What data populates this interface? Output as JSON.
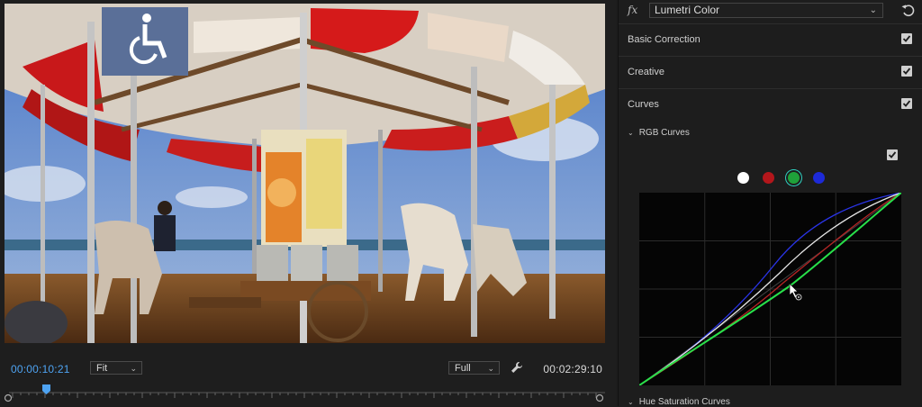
{
  "monitor": {
    "current_timecode": "00:00:10:21",
    "duration_timecode": "00:02:29:10",
    "zoom_select": "Fit",
    "resolution_select": "Full",
    "accessibility_sign": "wheelchair-icon"
  },
  "lumetri": {
    "fx_label": "fx",
    "effect_name": "Lumetri Color",
    "sections": [
      {
        "label": "Basic Correction",
        "checked": true
      },
      {
        "label": "Creative",
        "checked": true
      },
      {
        "label": "Curves",
        "checked": true
      }
    ],
    "rgb_curves_label": "RGB Curves",
    "rgb_curves_checked": true,
    "channels": [
      {
        "name": "luma",
        "color": "#ffffff",
        "selected": false
      },
      {
        "name": "red",
        "color": "#b3161b",
        "selected": false
      },
      {
        "name": "green",
        "color": "#1fa13a",
        "selected": true
      },
      {
        "name": "blue",
        "color": "#1d2ad8",
        "selected": false
      }
    ],
    "hue_saturation_label": "Hue Saturation Curves"
  },
  "colors": {
    "accent_blue": "#4ea3f2",
    "panel_bg": "#1d1d1d",
    "curve_green": "#28e04a",
    "curve_white": "#e6e6e6",
    "curve_red": "#b42424",
    "curve_blue": "#2a34e8"
  }
}
